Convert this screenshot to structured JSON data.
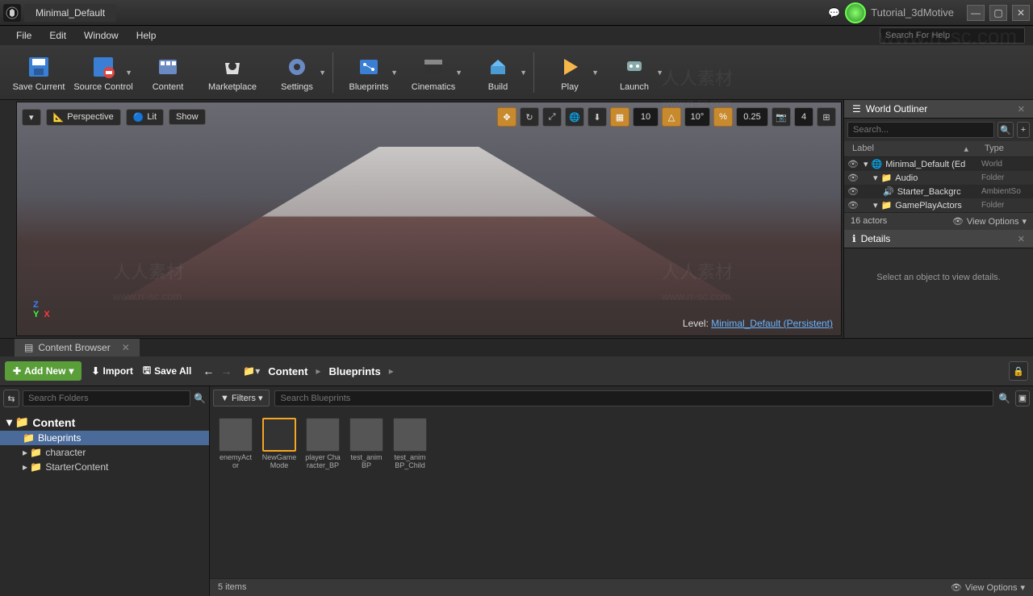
{
  "titlebar": {
    "tab": "Minimal_Default",
    "project": "Tutorial_3dMotive"
  },
  "menu": {
    "file": "File",
    "edit": "Edit",
    "window": "Window",
    "help": "Help",
    "search_placeholder": "Search For Help"
  },
  "toolbar": {
    "save_current": "Save Current",
    "source_control": "Source Control",
    "content": "Content",
    "marketplace": "Marketplace",
    "settings": "Settings",
    "blueprints": "Blueprints",
    "cinematics": "Cinematics",
    "build": "Build",
    "play": "Play",
    "launch": "Launch"
  },
  "viewport": {
    "mode": "Perspective",
    "lit": "Lit",
    "show": "Show",
    "snap_loc": "10",
    "snap_rot": "10°",
    "snap_scale": "0.25",
    "cam_speed": "4",
    "level_prefix": "Level:",
    "level_name": "Minimal_Default (Persistent)"
  },
  "outliner": {
    "title": "World Outliner",
    "search_placeholder": "Search...",
    "col_label": "Label",
    "col_type": "Type",
    "rows": [
      {
        "label": "Minimal_Default (Ed",
        "type": "World",
        "indent": 0
      },
      {
        "label": "Audio",
        "type": "Folder",
        "indent": 1
      },
      {
        "label": "Starter_Backgrc",
        "type": "AmbientSo",
        "indent": 2
      },
      {
        "label": "GamePlayActors",
        "type": "Folder",
        "indent": 1
      }
    ],
    "actor_count": "16 actors",
    "view_options": "View Options"
  },
  "details": {
    "title": "Details",
    "empty": "Select an object to view details."
  },
  "content_browser": {
    "title": "Content Browser",
    "add_new": "Add New",
    "import": "Import",
    "save_all": "Save All",
    "crumb_root": "Content",
    "crumb_leaf": "Blueprints",
    "tree_search_placeholder": "Search Folders",
    "tree": {
      "root": "Content",
      "children": [
        "Blueprints",
        "character",
        "StarterContent"
      ]
    },
    "filters": "Filters",
    "content_search_placeholder": "Search Blueprints",
    "assets": [
      {
        "name": "enemyActor"
      },
      {
        "name": "NewGame Mode"
      },
      {
        "name": "player Character_BP"
      },
      {
        "name": "test_anim BP"
      },
      {
        "name": "test_anim BP_Child"
      }
    ],
    "item_count": "5 items",
    "view_options": "View Options"
  },
  "watermarks": {
    "text": "人人素材",
    "url": "www.rr-sc.com"
  }
}
